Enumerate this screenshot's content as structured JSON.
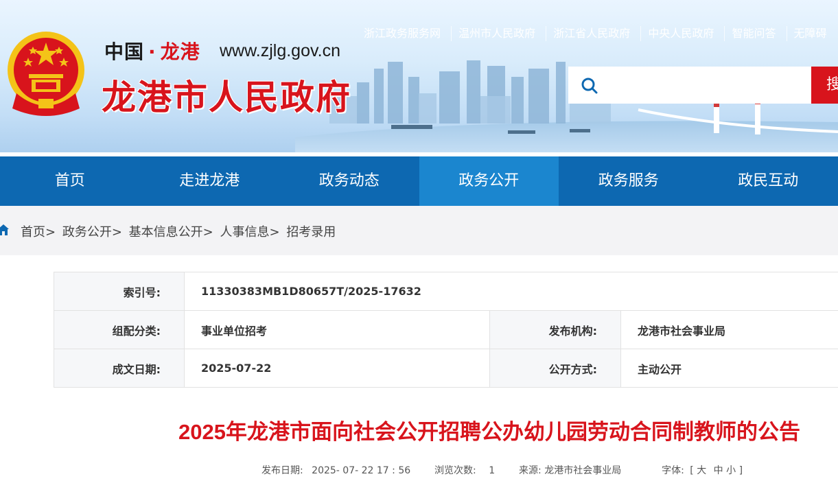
{
  "header": {
    "site_sub_left": "中国",
    "site_sub_dot": "·",
    "site_sub_right": "龙港",
    "domain": "www.zjlg.gov.cn",
    "site_title": "龙港市人民政府",
    "top_links": [
      "浙江政务服务网",
      "温州市人民政府",
      "浙江省人民政府",
      "中央人民政府",
      "智能问答",
      "无障碍"
    ],
    "search_placeholder": "",
    "search_button": "搜"
  },
  "nav": {
    "items": [
      {
        "label": "首页"
      },
      {
        "label": "走进龙港"
      },
      {
        "label": "政务动态"
      },
      {
        "label": "政务公开",
        "active": true
      },
      {
        "label": "政务服务"
      },
      {
        "label": "政民互动"
      }
    ]
  },
  "breadcrumb": {
    "items": [
      "首页",
      "政务公开",
      "基本信息公开",
      "人事信息",
      "招考录用"
    ],
    "separator": ">"
  },
  "info": {
    "index_label": "索引号:",
    "index_value": "11330383MB1D80657T/2025-17632",
    "category_label": "组配分类:",
    "category_value": "事业单位招考",
    "publisher_label": "发布机构:",
    "publisher_value": "龙港市社会事业局",
    "date_label": "成文日期:",
    "date_value": "2025-07-22",
    "mode_label": "公开方式:",
    "mode_value": "主动公开"
  },
  "article": {
    "title": "2025年龙港市面向社会公开招聘公办幼儿园劳动合同制教师的公告",
    "meta": {
      "date_label": "发布日期:",
      "date_value": "2025- 07- 22 17 : 56",
      "views_label": "浏览次数:",
      "views_value": "1",
      "source_label": "来源:",
      "source_value": "龙港市社会事业局",
      "font_label": "字体:",
      "font_open": "[",
      "font_large": "大",
      "font_medium": "中",
      "font_small": "小",
      "font_close": "]"
    }
  },
  "colors": {
    "brand_red": "#d8141c",
    "nav_blue": "#0d68b1",
    "nav_active": "#1b86cf"
  }
}
